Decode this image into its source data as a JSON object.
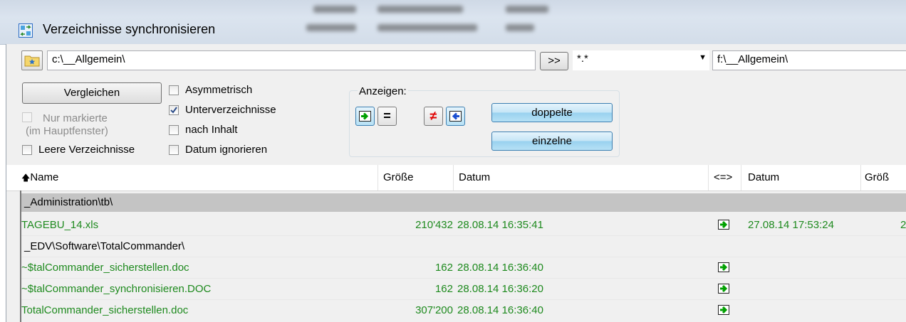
{
  "window": {
    "title": "Verzeichnisse synchronisieren"
  },
  "paths": {
    "left": "c:\\__Allgemein\\",
    "filter": "*.*",
    "right": "f:\\__Allgemein\\",
    "swap_label": ">>"
  },
  "options": {
    "compare_label": "Vergleichen",
    "only_marked_line1": "Nur markierte",
    "only_marked_line2": "(im Hauptfenster)",
    "empty_dirs": "Leere Verzeichnisse",
    "asymmetric": "Asymmetrisch",
    "subdirs": "Unterverzeichnisse",
    "by_content": "nach Inhalt",
    "ignore_date": "Datum ignorieren"
  },
  "show": {
    "label": "Anzeigen:",
    "equal_symbol": "=",
    "notequal_symbol": "≠",
    "duplicates_label": "doppelte",
    "singles_label": "einzelne"
  },
  "columns": {
    "name": "Name",
    "size": "Größe",
    "date": "Datum",
    "dir": "<=>",
    "date2": "Datum",
    "size2": "Größ"
  },
  "rows": [
    {
      "type": "group",
      "name": "_Administration\\tb\\"
    },
    {
      "type": "file",
      "name": "TAGEBU_14.xls",
      "size": "210'432",
      "date": "28.08.14 16:35:41",
      "date2": "27.08.14 17:53:24",
      "size2": "2"
    },
    {
      "type": "group",
      "name": "_EDV\\Software\\TotalCommander\\"
    },
    {
      "type": "file",
      "name": "~$talCommander_sicherstellen.doc",
      "size": "162",
      "date": "28.08.14 16:36:40",
      "date2": "",
      "size2": ""
    },
    {
      "type": "file",
      "name": "~$talCommander_synchronisieren.DOC",
      "size": "162",
      "date": "28.08.14 16:36:20",
      "date2": "",
      "size2": ""
    },
    {
      "type": "file",
      "name": "TotalCommander_sicherstellen.doc",
      "size": "307'200",
      "date": "28.08.14 16:36:40",
      "date2": "",
      "size2": ""
    }
  ],
  "colors": {
    "file_text": "#1e8a1e",
    "group_bg": "#c4c4c4",
    "arrow": "#00a000"
  }
}
